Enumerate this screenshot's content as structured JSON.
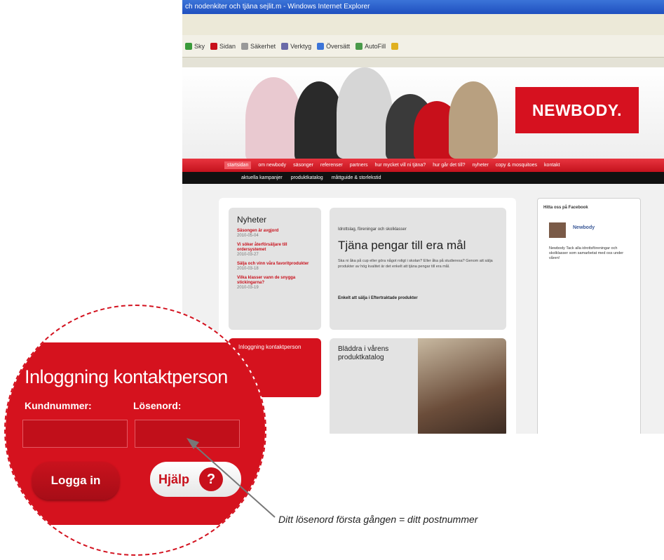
{
  "browser": {
    "title": "ch nodenkiter och tjäna sejlit.m - Windows Internet Explorer",
    "toolbar": [
      "Sky",
      "Sidan",
      "Säkerhet",
      "Verktyg",
      "Översätt",
      "AutoFill"
    ]
  },
  "site": {
    "logo": "NEWBODY.",
    "nav": [
      "startsidan",
      "om newbody",
      "säsonger",
      "referenser",
      "partners",
      "hur mycket vill ni tjäna?",
      "hur går det till?",
      "nyheter",
      "copy & mosquitoes",
      "kontakt"
    ],
    "subnav": [
      "aktuella kampanjer",
      "produktkatalog",
      "måttguide & storlekstid"
    ],
    "news": {
      "title": "Nyheter",
      "items": [
        {
          "text": "Säsongen är avgjord",
          "date": "2010-05-04"
        },
        {
          "text": "Vi söker återförsäljare till ordersystemet",
          "date": "2010-03-27"
        },
        {
          "text": "Sälja och vinn våra favoritprodukter",
          "date": "2010-03-18"
        },
        {
          "text": "Vilka klasser vann de snygga stickingarna?",
          "date": "2010-03-19"
        }
      ]
    },
    "earn": {
      "small": "Idrottslag, föreningar och skolklasser",
      "title": "Tjäna pengar till era mål",
      "para": "Ska ni åka på cup eller göra något roligt i skolan? Eller åka på studieresa? Genom att sälja produkter av hög kvalitet är det enkelt att tjäna pengar till era mål.",
      "link": "Enkelt att sälja i Eftertraktade produkter"
    },
    "mini_login": "Inloggning kontaktperson",
    "catalog": "Bläddra i vårens produktkatalog",
    "facebook": {
      "title": "Hitta oss på Facebook",
      "name": "Newbody",
      "feed": "Newbody Tack alla idrottsföreningar och skolklasser som samarbetat med oss under våren!"
    }
  },
  "magnifier": {
    "title": "Inloggning kontaktperson",
    "customer_label": "Kundnummer:",
    "password_label": "Lösenord:",
    "login_button": "Logga in",
    "help_button": "Hjälp",
    "help_icon": "?"
  },
  "annotation": "Ditt lösenord första gången = ditt postnummer",
  "colors": {
    "brand_red": "#d5121e",
    "dark_red": "#c10f1a",
    "nav_black": "#111111"
  }
}
